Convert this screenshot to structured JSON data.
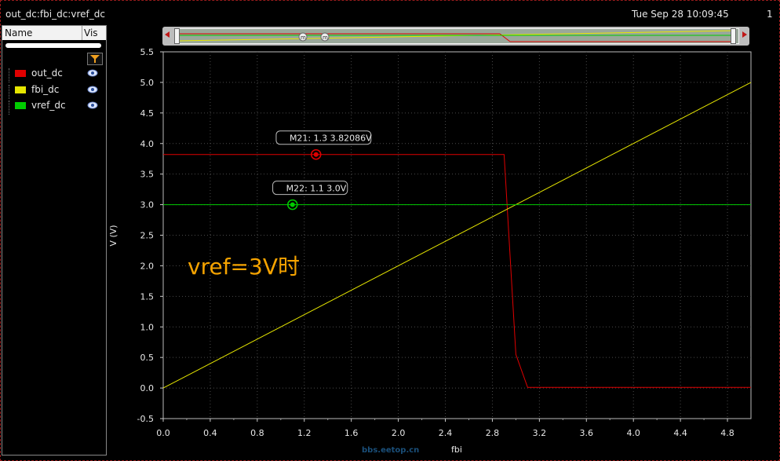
{
  "window": {
    "title": "out_dc:fbi_dc:vref_dc",
    "timestamp": "Tue Sep 28 10:09:45",
    "page_number": "1"
  },
  "side_panel": {
    "col_name": "Name",
    "col_vis": "Vis",
    "filter_icon": "filter-icon",
    "signals": [
      {
        "label": "out_dc",
        "color": "#e00000",
        "visible_icon": "eye-icon"
      },
      {
        "label": "fbi_dc",
        "color": "#e6e600",
        "visible_icon": "eye-icon"
      },
      {
        "label": "vref_dc",
        "color": "#00cc00",
        "visible_icon": "eye-icon"
      }
    ]
  },
  "overview": {
    "left_icon": "arrow-left-icon",
    "right_icon": "arrow-right-icon",
    "marker_icon": "marker-m-icon"
  },
  "annotation": "vref=3V时",
  "watermark": "bbs.eetop.cn",
  "colors": {
    "background": "#000000",
    "grid": "#555555",
    "out_dc": "#e00000",
    "fbi_dc": "#e6e600",
    "vref_dc": "#00cc00",
    "annotation": "#f5a300"
  },
  "chart_data": {
    "type": "line",
    "xlabel": "fbi",
    "ylabel": "V (V)",
    "xlim": [
      0.0,
      5.0
    ],
    "ylim": [
      -0.5,
      5.5
    ],
    "x_ticks": [
      "0.0",
      "0.4",
      "0.8",
      "1.2",
      "1.6",
      "2.0",
      "2.4",
      "2.8",
      "3.2",
      "3.6",
      "4.0",
      "4.4",
      "4.8"
    ],
    "y_ticks": [
      "5.5",
      "5.0",
      "4.5",
      "4.0",
      "3.5",
      "3.0",
      "2.5",
      "2.0",
      "1.5",
      "1.0",
      "0.5",
      "0.0",
      "-0.5"
    ],
    "grid": true,
    "series": [
      {
        "name": "out_dc",
        "color": "#e00000",
        "x": [
          0.0,
          2.9,
          3.0,
          3.1,
          5.0
        ],
        "y": [
          3.82086,
          3.82086,
          0.55,
          0.01,
          0.01
        ]
      },
      {
        "name": "fbi_dc",
        "color": "#e6e600",
        "x": [
          0.0,
          5.0
        ],
        "y": [
          0.0,
          5.0
        ]
      },
      {
        "name": "vref_dc",
        "color": "#00cc00",
        "x": [
          0.0,
          5.0
        ],
        "y": [
          3.0,
          3.0
        ]
      }
    ],
    "markers": [
      {
        "label": "M21: 1.3 3.82086V",
        "x": 1.3,
        "y": 3.82086,
        "color": "#e00000"
      },
      {
        "label": "M22: 1.1 3.0V",
        "x": 1.1,
        "y": 3.0,
        "color": "#00cc00"
      }
    ]
  }
}
